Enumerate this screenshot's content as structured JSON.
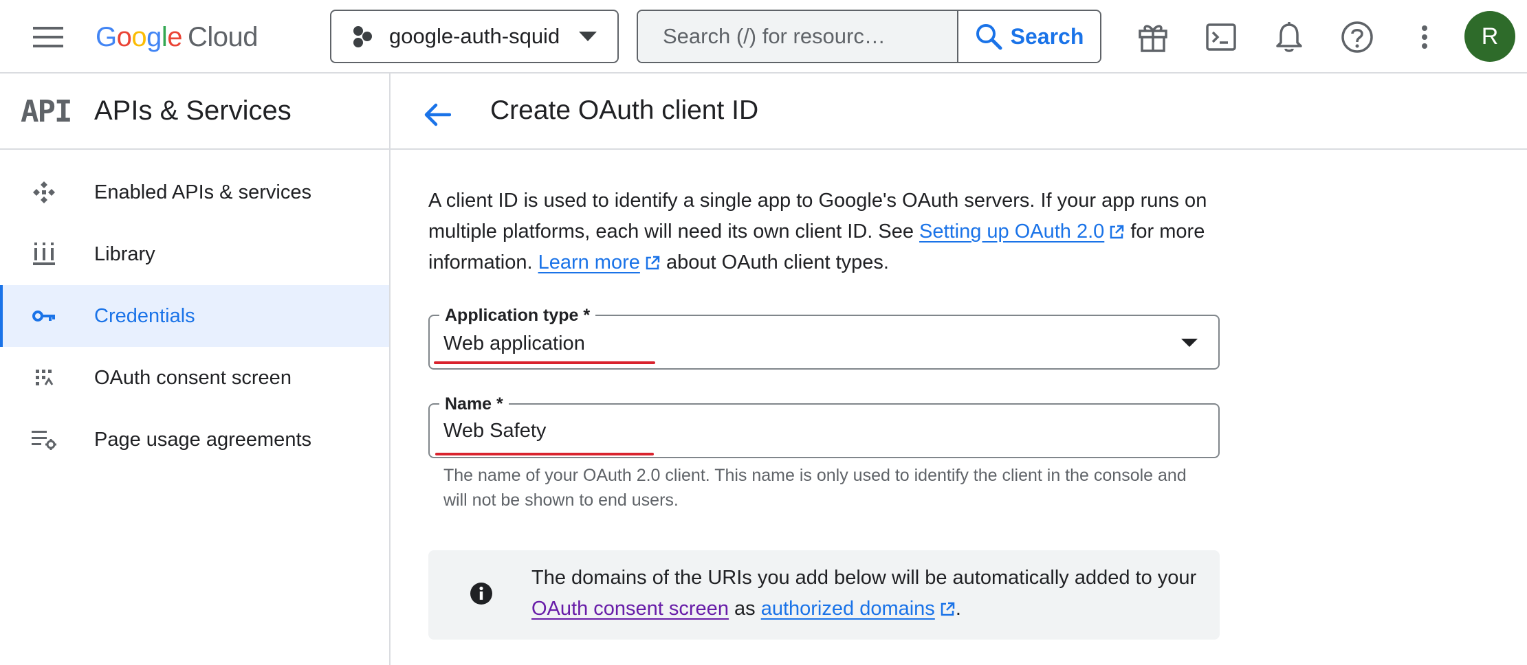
{
  "topbar": {
    "logo_google": "Google",
    "logo_cloud": "Cloud",
    "project_name": "google-auth-squid",
    "search_placeholder": "Search (/) for resourc…",
    "search_button": "Search",
    "avatar_initial": "R",
    "icons": [
      "menu-icon",
      "project-icon",
      "chevron-down-icon",
      "search-icon",
      "gift-icon",
      "terminal-icon",
      "bell-icon",
      "help-icon",
      "more-vert-icon"
    ]
  },
  "sidebar": {
    "logo_text": "API",
    "title": "APIs & Services",
    "items": [
      {
        "label": "Enabled APIs & services",
        "icon": "enabled-apis-icon",
        "active": false
      },
      {
        "label": "Library",
        "icon": "library-icon",
        "active": false
      },
      {
        "label": "Credentials",
        "icon": "key-icon",
        "active": true
      },
      {
        "label": "OAuth consent screen",
        "icon": "consent-screen-icon",
        "active": false
      },
      {
        "label": "Page usage agreements",
        "icon": "agreements-icon",
        "active": false
      }
    ]
  },
  "main": {
    "title": "Create OAuth client ID",
    "intro": {
      "part1": "A client ID is used to identify a single app to Google's OAuth servers. If your app runs on multiple platforms, each will need its own client ID. See ",
      "link1": "Setting up OAuth 2.0",
      "part2": " for more information. ",
      "link2": "Learn more",
      "part3": " about OAuth client types."
    },
    "app_type": {
      "label": "Application type *",
      "value": "Web application"
    },
    "name_field": {
      "label": "Name *",
      "value": "Web Safety"
    },
    "helper": "The name of your OAuth 2.0 client. This name is only used to identify the client in the console and will not be shown to end users.",
    "info": {
      "part1": "The domains of the URIs you add below will be automatically added to your ",
      "link1": "OAuth consent screen",
      "part2": " as ",
      "link2": "authorized domains",
      "part3": "."
    }
  },
  "colors": {
    "accent": "#1a73e8",
    "visited_link": "#681da8",
    "annotation_red": "#d9232e",
    "avatar_bg": "#2e6b2a",
    "active_nav_bg": "#e8f0fe"
  }
}
